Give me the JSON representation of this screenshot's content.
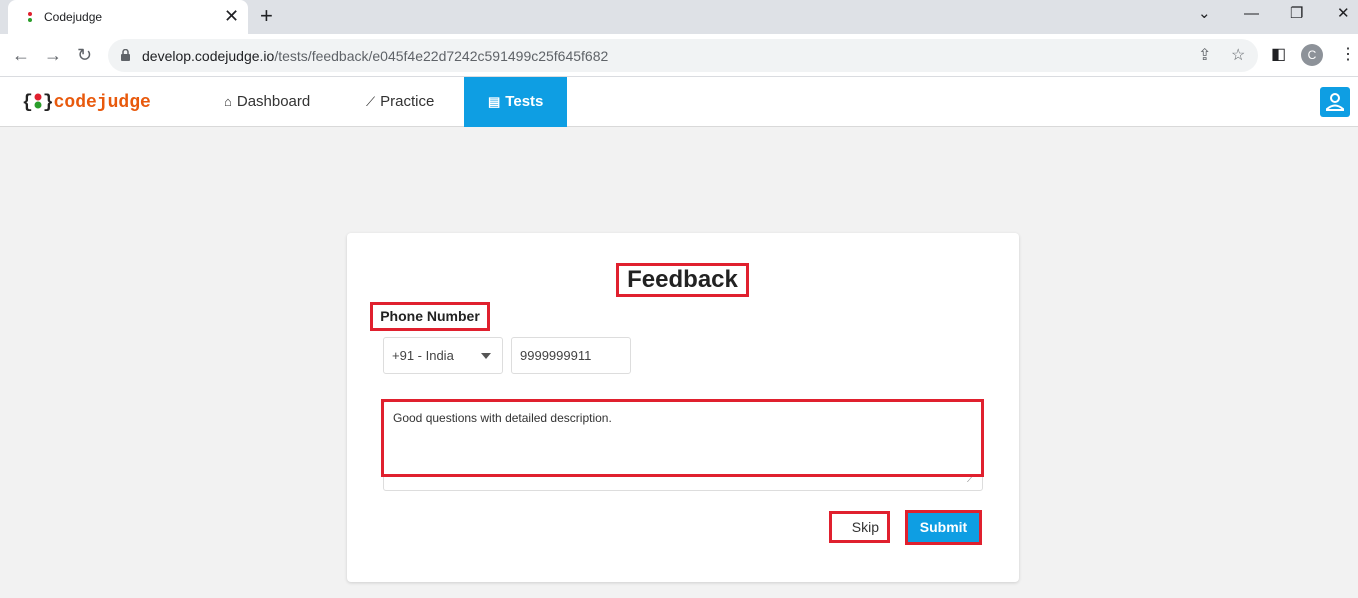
{
  "browser": {
    "tab_title": "Codejudge",
    "url_host": "develop.codejudge.io",
    "url_path": "/tests/feedback/e045f4e22d7242c591499c25f645f682",
    "profile_initial": "C"
  },
  "nav": {
    "logo_text": "codejudge",
    "logo_open_brace": "{",
    "logo_close_brace": "}",
    "links": [
      {
        "label": "Dashboard",
        "icon": "home-icon"
      },
      {
        "label": "Practice",
        "icon": "trend-icon"
      },
      {
        "label": "Tests",
        "icon": "clipboard-icon"
      }
    ],
    "active_link": "Tests",
    "accent_color": "#0e9ee3"
  },
  "form": {
    "title": "Feedback",
    "phone_label": "Phone Number",
    "country_code": "+91 - India",
    "phone_value": "9999999911",
    "feedback_text": "Good  questions with detailed description.",
    "skip_label": "Skip",
    "submit_label": "Submit",
    "highlight_color": "#e0202e"
  }
}
